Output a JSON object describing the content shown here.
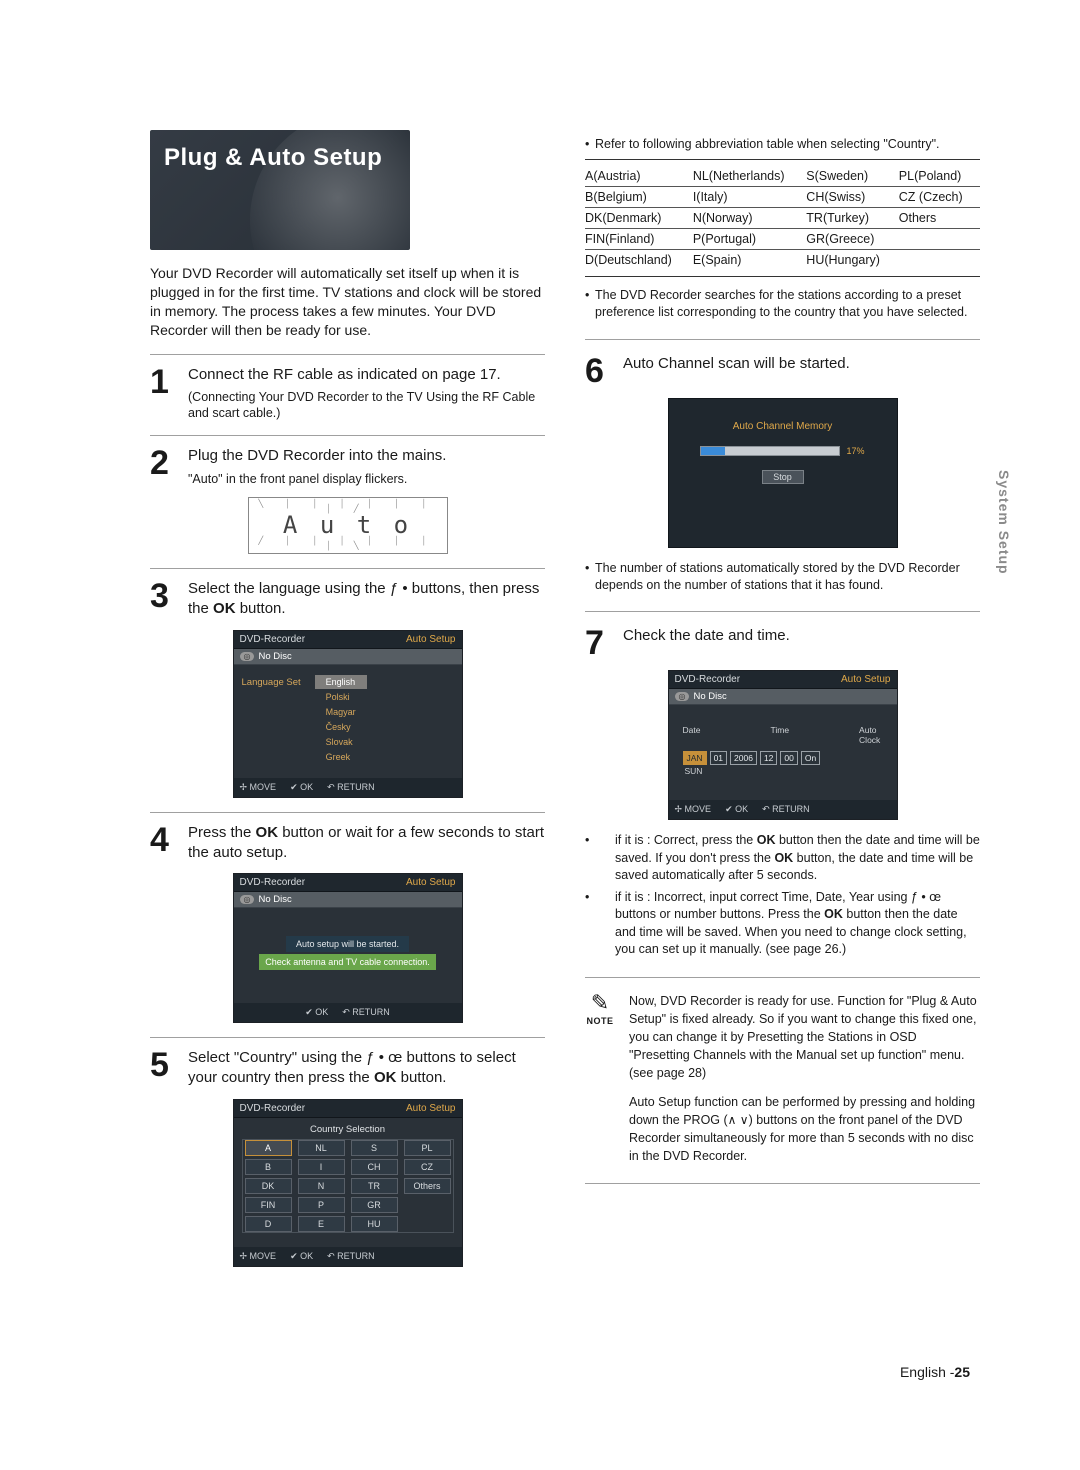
{
  "side_tab": "System Setup",
  "section_title": "Plug & Auto Setup",
  "intro_text": "Your DVD Recorder will automatically set itself up when it is plugged in for the first time. TV stations and clock will be stored in memory. The process takes a few minutes. Your DVD Recorder will then be ready for use.",
  "segment_display": "A u t o",
  "steps": {
    "s1": {
      "num": "1",
      "text": "Connect the RF cable as indicated on page 17.",
      "sub": "(Connecting Your DVD Recorder to the TV Using the RF Cable and scart cable.)"
    },
    "s2": {
      "num": "2",
      "text_a": "Plug the DVD Recorder into the mains.",
      "text_b": "\"Auto\" in the front panel display flickers."
    },
    "s3": {
      "num": "3",
      "text_a": "Select the language using the ",
      "text_b": " buttons, then press the ",
      "text_c": " button.",
      "btn_glyphs": "ƒ •",
      "ok": "OK"
    },
    "s4": {
      "num": "4",
      "text_a": "Press the ",
      "ok": "OK",
      "text_b": " button or wait for a few seconds to start the auto setup."
    },
    "s5": {
      "num": "5",
      "text_a": "Select \"Country\" using the ",
      "btn_glyphs": "ƒ • œ",
      "text_b": " buttons to select your country then press the ",
      "ok": "OK",
      "text_c": " button."
    },
    "s6": {
      "num": "6",
      "text": "Auto Channel scan will be started."
    },
    "s7": {
      "num": "7",
      "text": "Check the date and time."
    }
  },
  "osd": {
    "brand": "DVD-Recorder",
    "mode": "Auto Setup",
    "nodisc": "No Disc",
    "move": "MOVE",
    "ok": "OK",
    "return": "RETURN",
    "lang_label": "Language Set",
    "languages": [
      "English",
      "Polski",
      "Magyar",
      "Česky",
      "Slovak",
      "Greek"
    ],
    "msg_line1": "Auto setup will be started.",
    "msg_line2": "Check antenna and TV cable connection.",
    "country_title": "Country Selection",
    "country_grid": [
      [
        "A",
        "NL",
        "S",
        "PL"
      ],
      [
        "B",
        "I",
        "CH",
        "CZ"
      ],
      [
        "DK",
        "N",
        "TR",
        "Others"
      ],
      [
        "FIN",
        "P",
        "GR",
        ""
      ],
      [
        "D",
        "E",
        "HU",
        ""
      ]
    ],
    "scan_title": "Auto Channel Memory",
    "scan_pct": "17%",
    "scan_fill_pct": 17,
    "scan_stop": "Stop",
    "date_label": "Date",
    "time_label": "Time",
    "autoclock_label": "Auto Clock",
    "day_label": "SUN",
    "dt_values": [
      "JAN",
      "01",
      "2006",
      "12",
      "00",
      "On"
    ]
  },
  "countries_note": "Refer to following abbreviation table when selecting \"Country\".",
  "countries_table": [
    [
      "A(Austria)",
      "NL(Netherlands)",
      "S(Sweden)",
      "PL(Poland)"
    ],
    [
      "B(Belgium)",
      "I(Italy)",
      "CH(Swiss)",
      "CZ (Czech)"
    ],
    [
      "DK(Denmark)",
      "N(Norway)",
      "TR(Turkey)",
      "Others"
    ],
    [
      "FIN(Finland)",
      "P(Portugal)",
      "GR(Greece)",
      ""
    ],
    [
      "D(Deutschland)",
      "E(Spain)",
      "HU(Hungary)",
      ""
    ]
  ],
  "after_table_note": "The DVD Recorder searches for the stations according to a preset preference list corresponding to the country that you have selected.",
  "stations_found_note": "The number of stations automatically stored by the DVD Recorder depends on the number of stations that it has found.",
  "dt_bullets": {
    "correct_a": "if it is : Correct, press the ",
    "ok": "OK",
    "correct_b": " button then the date and time will be saved. If you don't press the ",
    "correct_c": " button, the date and time will be saved automatically after 5 seconds.",
    "incorrect_a": "if it is : Incorrect, input correct Time, Date, Year using ",
    "btn_glyphs": "ƒ • œ",
    "incorrect_b": " buttons or number buttons. Press the ",
    "incorrect_c": " button then the date and time will be saved. When you need to change clock setting, you can set up it manually. (see page 26.)"
  },
  "note_label": "NOTE",
  "note_text_1": "Now, DVD Recorder is ready for use. Function for \"Plug & Auto Setup\" is fixed already. So if you want to change this fixed one, you can change it by Presetting the Stations in OSD \"Presetting Channels with the Manual set up function\" menu. (see page 28)",
  "note_text_2a": "Auto Setup function can be performed by pressing and holding down the PROG (",
  "note_text_2b": ") buttons on the front panel of the DVD Recorder simultaneously for more than 5 seconds with no disc in the DVD Recorder.",
  "footer_lang": "English -",
  "footer_page": "25"
}
